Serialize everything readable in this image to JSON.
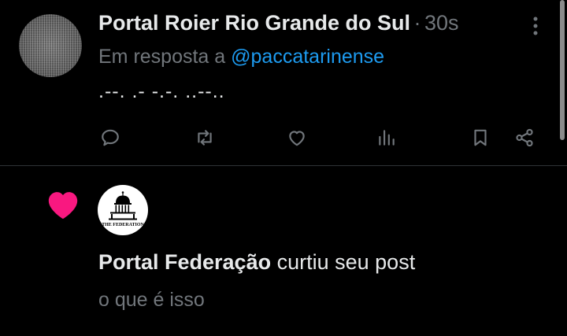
{
  "post": {
    "author": "Portal Roier Rio Grande do Sul",
    "separator": "·",
    "time": "30s",
    "reply_prefix": "Em resposta a",
    "reply_handle": "@paccatarinense",
    "text": ".--. .- -.-. ..--..",
    "actions": [
      "reply-icon",
      "repost-icon",
      "like-icon",
      "views-icon",
      "bookmark-icon",
      "share-icon"
    ]
  },
  "notification": {
    "icon": "heart-icon",
    "avatar_text": "THE FEDERATION",
    "user": "Portal Federação",
    "action": "curtiu seu post",
    "quote": "o que é isso"
  },
  "colors": {
    "background": "#000000",
    "primary_text": "#e7e9ea",
    "secondary_text": "#71767b",
    "link": "#1d9bf0",
    "heart": "#f91880",
    "divider": "#2f3336"
  }
}
